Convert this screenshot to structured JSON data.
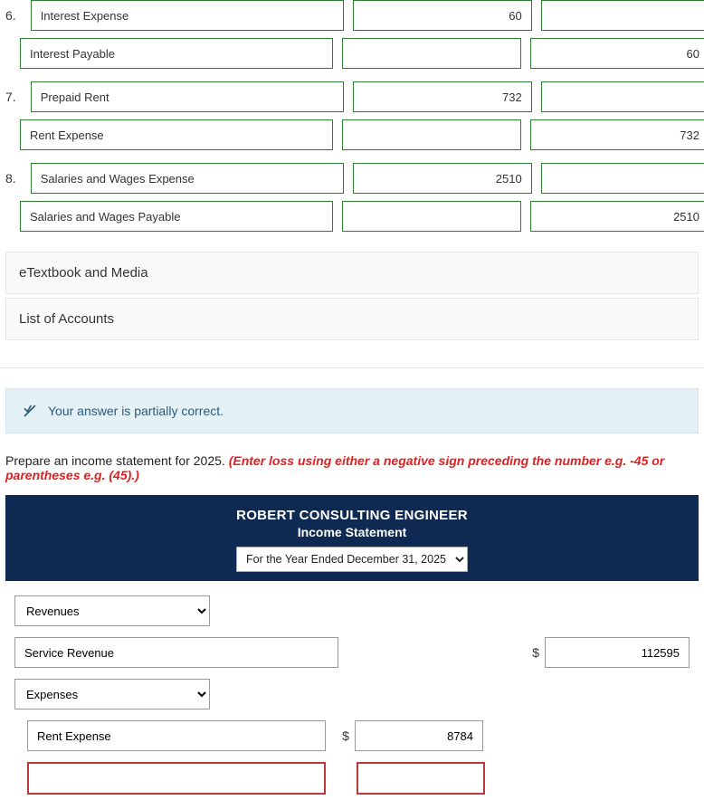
{
  "journal": {
    "rows": [
      {
        "num": "6.",
        "account": "Interest Expense",
        "debit": "60",
        "credit": ""
      },
      {
        "num": "",
        "account": "Interest Payable",
        "debit": "",
        "credit": "60"
      },
      {
        "num": "7.",
        "account": "Prepaid Rent",
        "debit": "732",
        "credit": ""
      },
      {
        "num": "",
        "account": "Rent Expense",
        "debit": "",
        "credit": "732"
      },
      {
        "num": "8.",
        "account": "Salaries and Wages Expense",
        "debit": "2510",
        "credit": ""
      },
      {
        "num": "",
        "account": "Salaries and Wages Payable",
        "debit": "",
        "credit": "2510"
      }
    ]
  },
  "links": {
    "etextbook": "eTextbook and Media",
    "accounts": "List of Accounts"
  },
  "status": {
    "message": "Your answer is partially correct."
  },
  "instructions": {
    "text": "Prepare an income statement for 2025. ",
    "hint": "(Enter loss using either a negative sign preceding the number e.g. -45 or parentheses e.g. (45).)"
  },
  "statement": {
    "company": "ROBERT CONSULTING ENGINEER",
    "title": "Income Statement",
    "period_selected": "For the Year Ended December 31, 2025",
    "categories": {
      "revenues": "Revenues",
      "expenses": "Expenses"
    },
    "lines": {
      "service_revenue": {
        "label": "Service Revenue",
        "currency": "$",
        "value": "112595"
      },
      "rent_expense": {
        "label": "Rent Expense",
        "currency": "$",
        "value": "8784"
      }
    }
  }
}
